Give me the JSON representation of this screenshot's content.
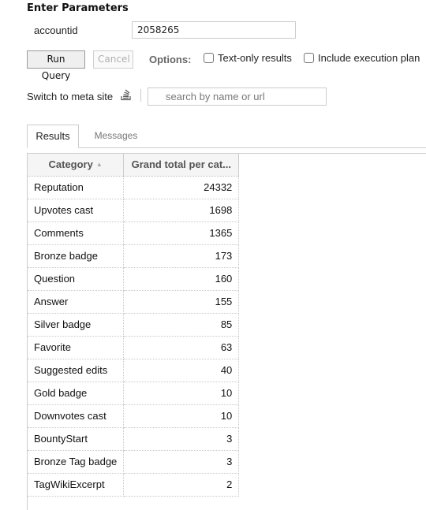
{
  "parameters": {
    "title": "Enter Parameters",
    "fields": [
      {
        "label": "accountid",
        "value": "2058265"
      }
    ]
  },
  "toolbar": {
    "run_label": "Run Query",
    "cancel_label": "Cancel",
    "options_label": "Options:",
    "options": [
      {
        "label": "Text-only results",
        "checked": false
      },
      {
        "label": "Include execution plan",
        "checked": false
      }
    ]
  },
  "site_switcher": {
    "meta_link": "Switch to meta site",
    "icon": "stack-exchange-icon",
    "search_placeholder": "search by name or url",
    "search_value": ""
  },
  "tabs": [
    {
      "label": "Results",
      "active": true
    },
    {
      "label": "Messages",
      "active": false
    }
  ],
  "results": {
    "columns": [
      {
        "label": "Category",
        "sort": "ascending",
        "sort_icon": "sort-up-icon"
      },
      {
        "label": "Grand total per cat..."
      }
    ],
    "rows": [
      {
        "category": "Reputation",
        "total": "24332"
      },
      {
        "category": "Upvotes cast",
        "total": "1698"
      },
      {
        "category": "Comments",
        "total": "1365"
      },
      {
        "category": "Bronze badge",
        "total": "173"
      },
      {
        "category": "Question",
        "total": "160"
      },
      {
        "category": "Answer",
        "total": "155"
      },
      {
        "category": "Silver badge",
        "total": "85"
      },
      {
        "category": "Favorite",
        "total": "63"
      },
      {
        "category": "Suggested edits",
        "total": "40"
      },
      {
        "category": "Gold badge",
        "total": "10"
      },
      {
        "category": "Downvotes cast",
        "total": "10"
      },
      {
        "category": "BountyStart",
        "total": "3"
      },
      {
        "category": "Bronze Tag badge",
        "total": "3"
      },
      {
        "category": "TagWikiExcerpt",
        "total": "2"
      }
    ]
  }
}
